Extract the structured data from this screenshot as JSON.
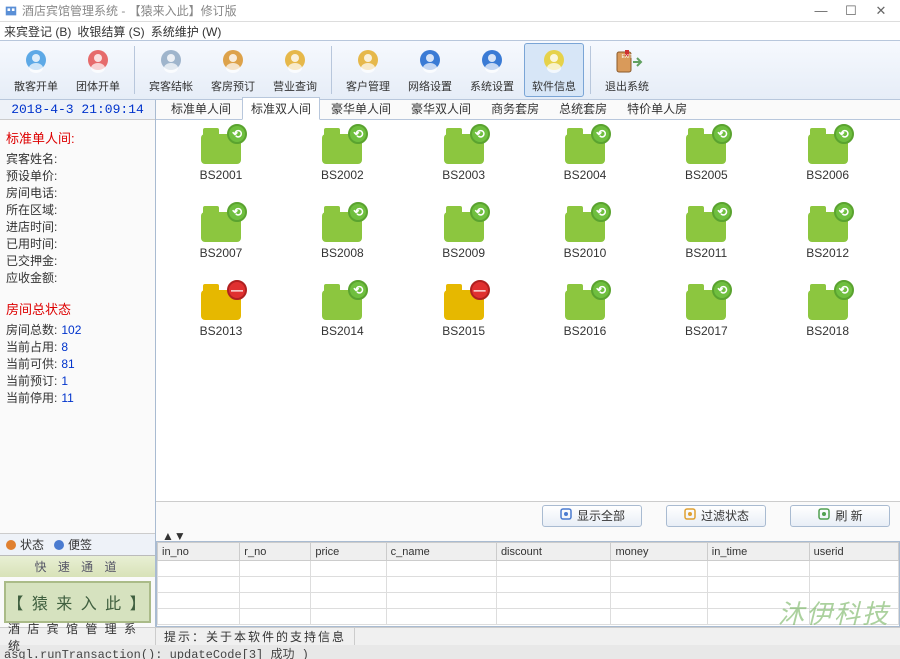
{
  "window": {
    "title": "酒店宾馆管理系统 - 【猿来入此】修订版",
    "min": "—",
    "max": "☐",
    "close": "✕"
  },
  "menus": [
    "来宾登记 (B)",
    "收银结算 (S)",
    "系统维护 (W)"
  ],
  "toolbar_groups": [
    {
      "items": [
        {
          "name": "single-open",
          "label": "散客开单",
          "color": "#5da9e6",
          "exit": false
        },
        {
          "name": "group-open",
          "label": "团体开单",
          "color": "#e66b6b",
          "exit": false
        }
      ]
    },
    {
      "items": [
        {
          "name": "guest-bill",
          "label": "宾客结帐",
          "color": "#9fb5cc",
          "exit": false
        },
        {
          "name": "room-reserve",
          "label": "客房预订",
          "color": "#dda24a",
          "exit": false
        },
        {
          "name": "biz-query",
          "label": "营业查询",
          "color": "#e6b84a",
          "exit": false
        }
      ]
    },
    {
      "items": [
        {
          "name": "customer-mgmt",
          "label": "客户管理",
          "color": "#e6b84a",
          "exit": false
        },
        {
          "name": "network-cfg",
          "label": "网络设置",
          "color": "#3a7bd5",
          "exit": false
        },
        {
          "name": "system-cfg",
          "label": "系统设置",
          "color": "#3a7bd5",
          "exit": false
        },
        {
          "name": "software-info",
          "label": "软件信息",
          "color": "#e6d24a",
          "selected": true,
          "exit": false
        }
      ]
    },
    {
      "items": [
        {
          "name": "exit-system",
          "label": "退出系统",
          "color": "#d99a5a",
          "exit": true
        }
      ]
    }
  ],
  "datetime": "2018-4-3 21:09:14",
  "guest_info": {
    "title": "标准单人间:",
    "rows": [
      {
        "label": "宾客姓名:",
        "value": ""
      },
      {
        "label": "预设单价:",
        "value": ""
      },
      {
        "label": "房间电话:",
        "value": ""
      },
      {
        "label": "所在区域:",
        "value": ""
      },
      {
        "label": "进店时间:",
        "value": ""
      },
      {
        "label": "已用时间:",
        "value": ""
      },
      {
        "label": "已交押金:",
        "value": ""
      },
      {
        "label": "应收金额:",
        "value": ""
      }
    ]
  },
  "room_summary": {
    "title": "房间总状态",
    "rows": [
      {
        "label": "房间总数:",
        "value": "102"
      },
      {
        "label": "当前占用:",
        "value": "8"
      },
      {
        "label": "当前可供:",
        "value": "81"
      },
      {
        "label": "当前预订:",
        "value": "1"
      },
      {
        "label": "当前停用:",
        "value": "11"
      }
    ]
  },
  "left_tabs": [
    {
      "name": "status-tab",
      "label": "状态",
      "color": "#e08030"
    },
    {
      "name": "note-tab",
      "label": "便签",
      "color": "#4a7bd0"
    }
  ],
  "quick": {
    "title": "快 速 通 道",
    "button": "【 猿 来 入 此 】"
  },
  "tabs": [
    {
      "label": "标准单人间",
      "active": false
    },
    {
      "label": "标准双人间",
      "active": true
    },
    {
      "label": "豪华单人间",
      "active": false
    },
    {
      "label": "豪华双人间",
      "active": false
    },
    {
      "label": "商务套房",
      "active": false
    },
    {
      "label": "总统套房",
      "active": false
    },
    {
      "label": "特价单人房",
      "active": false
    }
  ],
  "rooms": [
    {
      "id": "BS2001",
      "busy": false
    },
    {
      "id": "BS2002",
      "busy": false
    },
    {
      "id": "BS2003",
      "busy": false
    },
    {
      "id": "BS2004",
      "busy": false
    },
    {
      "id": "BS2005",
      "busy": false
    },
    {
      "id": "BS2006",
      "busy": false
    },
    {
      "id": "BS2007",
      "busy": false
    },
    {
      "id": "BS2008",
      "busy": false
    },
    {
      "id": "BS2009",
      "busy": false
    },
    {
      "id": "BS2010",
      "busy": false
    },
    {
      "id": "BS2011",
      "busy": false
    },
    {
      "id": "BS2012",
      "busy": false
    },
    {
      "id": "BS2013",
      "busy": true
    },
    {
      "id": "BS2014",
      "busy": false
    },
    {
      "id": "BS2015",
      "busy": true
    },
    {
      "id": "BS2016",
      "busy": false
    },
    {
      "id": "BS2017",
      "busy": false
    },
    {
      "id": "BS2018",
      "busy": false
    }
  ],
  "action_buttons": [
    {
      "name": "show-all",
      "label": "显示全部",
      "color": "#4a7bd0"
    },
    {
      "name": "filter-status",
      "label": "过滤状态",
      "color": "#e0a030"
    },
    {
      "name": "refresh",
      "label": "刷    新",
      "color": "#50a050"
    }
  ],
  "grid_columns": [
    "in_no",
    "r_no",
    "price",
    "c_name",
    "discount",
    "money",
    "in_time",
    "userid"
  ],
  "statusbar": {
    "cell1": "酒 店 宾 馆 管 理 系 统",
    "cell2_prefix": "提示：",
    "cell2_text": "关于本软件的支持信息"
  },
  "watermark": "沐伊科技",
  "debug_line": "asgl.runTransaction(): updateCode[3] 成功 )"
}
